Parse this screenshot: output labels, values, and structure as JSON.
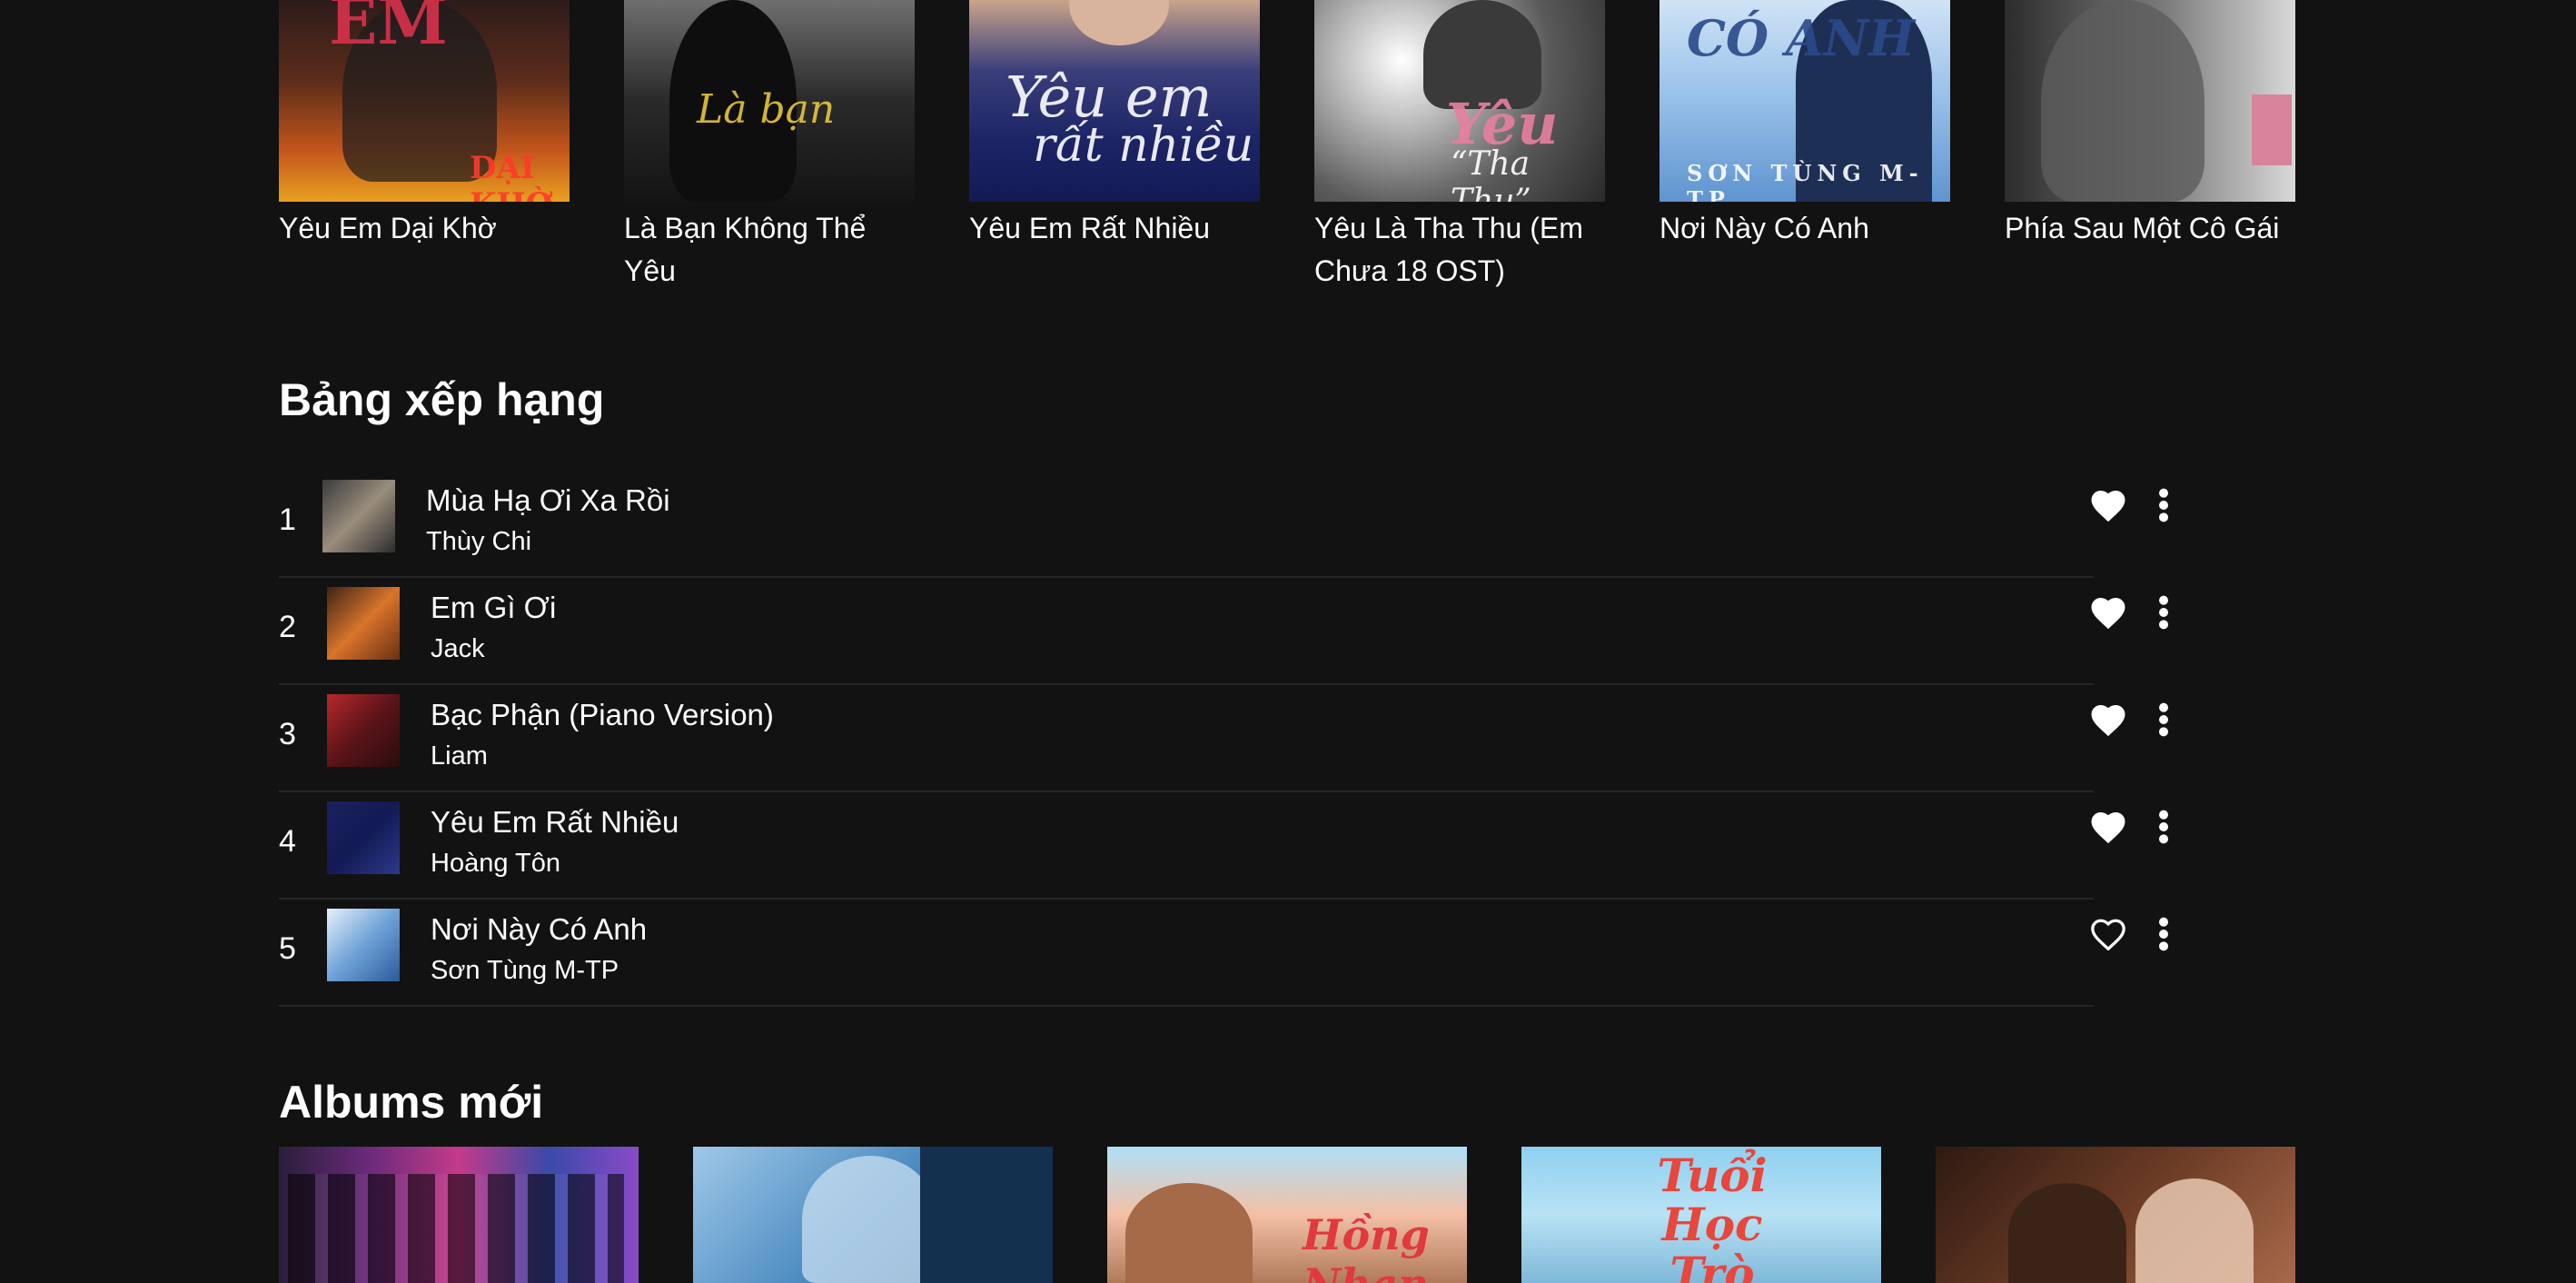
{
  "featured_albums": [
    {
      "title": "Yêu Em Dại Khờ"
    },
    {
      "title": "Là Bạn Không Thể Yêu"
    },
    {
      "title": "Yêu Em Rất Nhiều"
    },
    {
      "title": "Yêu Là Tha Thu (Em Chưa 18 OST)"
    },
    {
      "title": "Nơi Này Có Anh"
    },
    {
      "title": "Phía Sau Một Cô Gái"
    }
  ],
  "chart": {
    "heading": "Bảng xếp hạng",
    "items": [
      {
        "rank": "1",
        "song": "Mùa Hạ Ơi Xa Rồi",
        "artist": "Thùy Chi",
        "liked": true
      },
      {
        "rank": "2",
        "song": "Em Gì Ơi",
        "artist": "Jack",
        "liked": true
      },
      {
        "rank": "3",
        "song": "Bạc Phận (Piano Version)",
        "artist": "Liam",
        "liked": true
      },
      {
        "rank": "4",
        "song": "Yêu Em Rất Nhiều",
        "artist": "Hoàng Tôn",
        "liked": true
      },
      {
        "rank": "5",
        "song": "Nơi Này Có Anh",
        "artist": "Sơn Tùng M-TP",
        "liked": false
      }
    ]
  },
  "new_albums": {
    "heading": "Albums mới",
    "items": [
      {
        "cover_text": ""
      },
      {
        "cover_text": ""
      },
      {
        "cover_text": "Hồng Nhan"
      },
      {
        "cover_text": "Tuổi Học Trò"
      },
      {
        "cover_text": ""
      }
    ]
  },
  "icons": {
    "heart": "heart-icon",
    "more": "more-vertical-icon"
  },
  "colors": {
    "background": "#121212",
    "text": "#ffffff",
    "divider": "#262626"
  }
}
